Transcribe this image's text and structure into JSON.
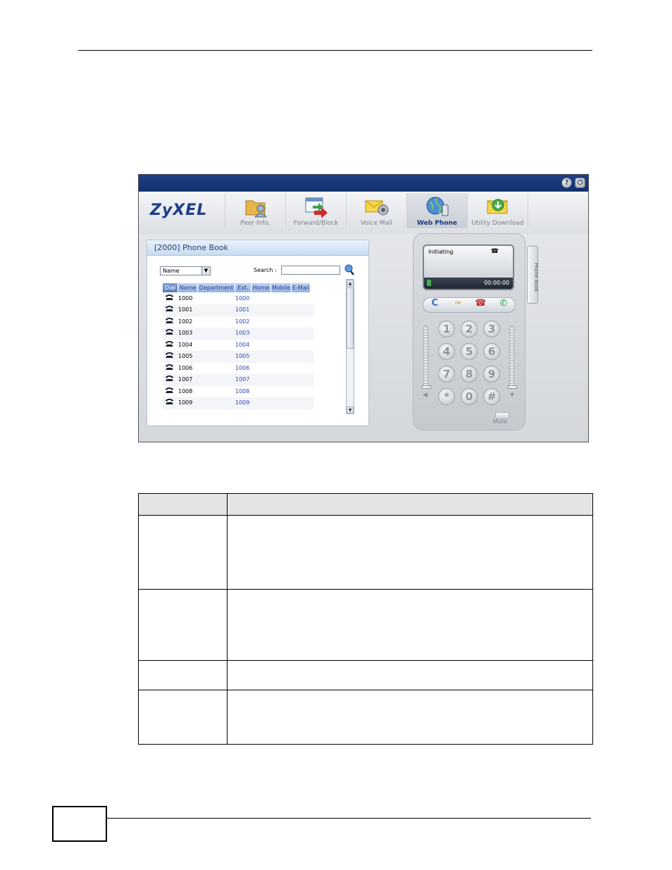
{
  "app": {
    "logo": "ZyXEL",
    "help_icon": "?",
    "nav": [
      {
        "label": "Peer Info.",
        "icon": "folder-user-icon"
      },
      {
        "label": "Forward/Block",
        "icon": "forward-window-icon"
      },
      {
        "label": "Voice Mail",
        "icon": "voicemail-icon"
      },
      {
        "label": "Web Phone",
        "icon": "globe-phone-icon",
        "active": true
      },
      {
        "label": "Utility Download",
        "icon": "download-envelope-icon"
      }
    ]
  },
  "phonebook": {
    "title": "[2000] Phone Book",
    "sort_value": "Name",
    "search_label": "Search :",
    "search_value": "",
    "columns": [
      "Dial",
      "Name",
      "Department",
      "Ext.",
      "Home",
      "Mobile",
      "E-Mail"
    ],
    "rows": [
      {
        "name": "1000",
        "department": "",
        "ext": "1000",
        "home": "",
        "mobile": "",
        "email": ""
      },
      {
        "name": "1001",
        "department": "",
        "ext": "1001",
        "home": "",
        "mobile": "",
        "email": ""
      },
      {
        "name": "1002",
        "department": "",
        "ext": "1002",
        "home": "",
        "mobile": "",
        "email": ""
      },
      {
        "name": "1003",
        "department": "",
        "ext": "1003",
        "home": "",
        "mobile": "",
        "email": ""
      },
      {
        "name": "1004",
        "department": "",
        "ext": "1004",
        "home": "",
        "mobile": "",
        "email": ""
      },
      {
        "name": "1005",
        "department": "",
        "ext": "1005",
        "home": "",
        "mobile": "",
        "email": ""
      },
      {
        "name": "1006",
        "department": "",
        "ext": "1006",
        "home": "",
        "mobile": "",
        "email": ""
      },
      {
        "name": "1007",
        "department": "",
        "ext": "1007",
        "home": "",
        "mobile": "",
        "email": ""
      },
      {
        "name": "1008",
        "department": "",
        "ext": "1008",
        "home": "",
        "mobile": "",
        "email": ""
      },
      {
        "name": "1009",
        "department": "",
        "ext": "1009",
        "home": "",
        "mobile": "",
        "email": ""
      }
    ]
  },
  "webphone": {
    "status": "Initiating",
    "timer": "00:00:00",
    "clear_glyph": "C",
    "transfer_glyph": "⇒",
    "hangup_glyph": "☎",
    "answer_glyph": "✆",
    "keys": [
      "1",
      "2",
      "3",
      "4",
      "5",
      "6",
      "7",
      "8",
      "9",
      "*",
      "0",
      "#"
    ],
    "mute_label": "Mute",
    "phonebook_tab_label": "Phone Book"
  },
  "doc_table": {
    "header": [
      "",
      ""
    ],
    "rows": [
      [
        "",
        ""
      ],
      [
        "",
        ""
      ],
      [
        "",
        ""
      ],
      [
        "",
        ""
      ]
    ]
  }
}
